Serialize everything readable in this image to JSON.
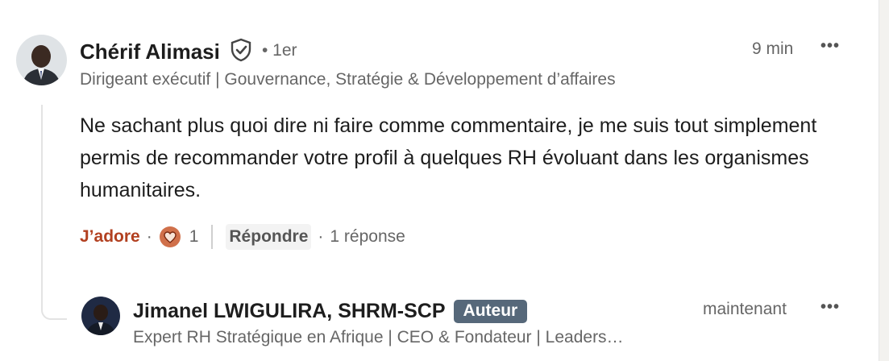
{
  "comment": {
    "author_name": "Chérif Alimasi",
    "degree": "• 1er",
    "headline": "Dirigeant exécutif | Gouvernance, Stratégie & Développement d’affaires",
    "time": "9 min",
    "more_label": "•••",
    "text": "Ne sachant plus quoi dire ni faire comme commentaire, je me suis tout simplement permis de recommander votre profil à quelques RH évoluant dans les organismes humanitaires.",
    "like_label": "J’adore",
    "reaction_icon": "heart-reaction-icon",
    "reaction_count": "1",
    "reply_label": "Répondre",
    "reply_count": "1 réponse",
    "colors": {
      "like": "#b24020",
      "reaction_bg": "#d0704a"
    }
  },
  "reply": {
    "author_name": "Jimanel LWIGULIRA, SHRM-SCP",
    "badge": "Auteur",
    "headline": "Expert RH Stratégique en Afrique | CEO & Fondateur | Leaders…",
    "time": "maintenant",
    "more_label": "•••",
    "colors": {
      "badge_bg": "#56687a"
    }
  }
}
